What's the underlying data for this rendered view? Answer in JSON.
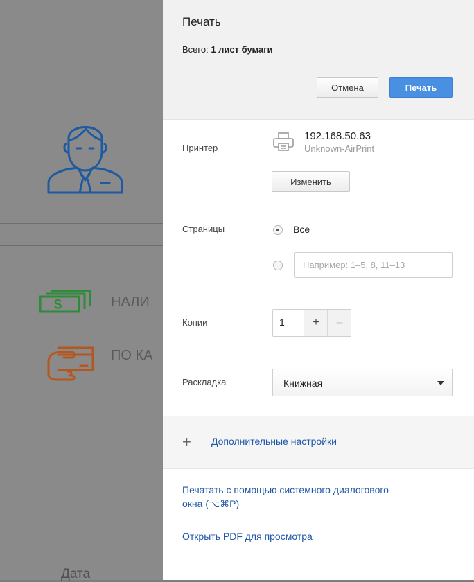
{
  "background": {
    "cash_label": "НАЛИ",
    "card_label": "ПО КА",
    "date_label": "Дата"
  },
  "dialog": {
    "title": "Печать",
    "summary_prefix": "Всего: ",
    "summary_value": "1 лист бумаги",
    "cancel_label": "Отмена",
    "print_label": "Печать",
    "printer_label": "Принтер",
    "printer_name": "192.168.50.63",
    "printer_sub": "Unknown-AirPrint",
    "change_label": "Изменить",
    "pages_label": "Страницы",
    "pages_all_label": "Все",
    "pages_placeholder": "Например: 1–5, 8, 11–13",
    "copies_label": "Копии",
    "copies_value": "1",
    "copies_plus": "+",
    "copies_minus": "–",
    "layout_label": "Раскладка",
    "layout_value": "Книжная",
    "more_settings_label": "Дополнительные настройки",
    "system_dialog_line1": "Печатать с помощью системного диалогового",
    "system_dialog_line2": "окна (⌥⌘P)",
    "open_pdf_label": "Открыть PDF для просмотра"
  },
  "colors": {
    "accent": "#4a90e2",
    "link": "#1f57a8",
    "avatar_blue": "#1e5aa0",
    "cash_green": "#2e8b3a",
    "card_orange": "#b5561e"
  },
  "icons": [
    "avatar-icon",
    "cash-icon",
    "card-icon",
    "printer-icon",
    "plus-icon",
    "chevron-down-icon"
  ]
}
